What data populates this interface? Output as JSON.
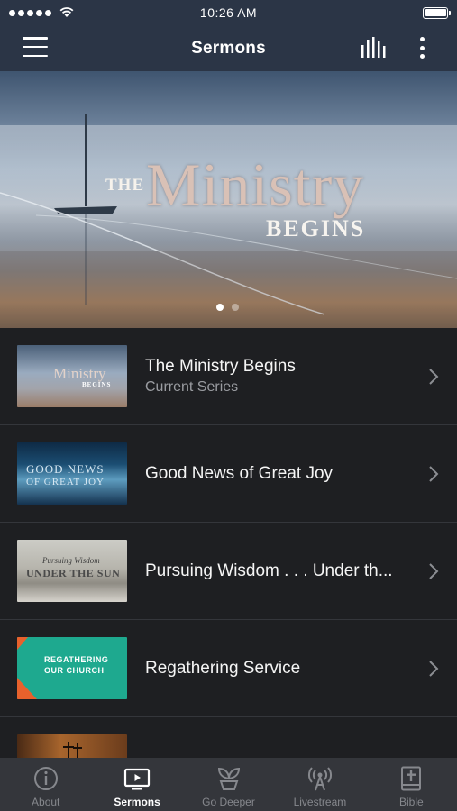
{
  "status_bar": {
    "time": "10:26 AM",
    "signal_bars": 5,
    "battery_level": 1.0
  },
  "header": {
    "title": "Sermons",
    "menu_icon": "hamburger-menu-icon",
    "bars_icon": "bar-chart-icon",
    "more_icon": "more-vertical-icon"
  },
  "hero": {
    "line_the": "THE",
    "line_main": "Ministry",
    "line_sub": "BEGINS",
    "page_count": 2,
    "active_page": 1
  },
  "series": [
    {
      "title": "The Ministry Begins",
      "subtitle": "Current Series",
      "thumb_main": "Ministry",
      "thumb_sub": "BEGINS"
    },
    {
      "title": "Good News of Great Joy",
      "subtitle": "",
      "thumb_main": "GOOD NEWS",
      "thumb_sub": "OF GREAT JOY"
    },
    {
      "title": "Pursuing Wisdom . . . Under th...",
      "subtitle": "",
      "thumb_main": "Pursuing Wisdom",
      "thumb_sub": "UNDER THE SUN"
    },
    {
      "title": "Regathering Service",
      "subtitle": "",
      "thumb_main": "REGATHERING",
      "thumb_sub": "OUR CHURCH"
    },
    {
      "title": "",
      "subtitle": "",
      "thumb_main": "",
      "thumb_sub": ""
    }
  ],
  "tabs": [
    {
      "label": "About",
      "icon": "info-icon",
      "active": false
    },
    {
      "label": "Sermons",
      "icon": "tv-play-icon",
      "active": true
    },
    {
      "label": "Go Deeper",
      "icon": "plant-sprout-icon",
      "active": false
    },
    {
      "label": "Livestream",
      "icon": "broadcast-antenna-icon",
      "active": false
    },
    {
      "label": "Bible",
      "icon": "bible-book-icon",
      "active": false
    }
  ],
  "colors": {
    "header_bg": "#2b3546",
    "list_bg": "#1e1f22",
    "tab_bar_bg": "#34363b",
    "tab_inactive": "#86888d",
    "tab_active": "#ffffff",
    "accent_teal": "#1ea98f"
  }
}
